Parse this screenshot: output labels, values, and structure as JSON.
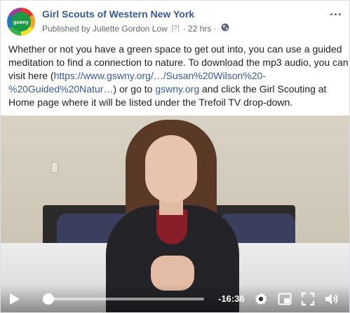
{
  "post": {
    "page_name": "Girl Scouts of Western New York",
    "published_by": "Published by Juliette Gordon Low",
    "help_marker": "[?]",
    "dot": "·",
    "time_ago": "22 hrs",
    "dot2": "·",
    "avatar_text": "gswny",
    "icons": {
      "more": "more-options-icon",
      "audience": "globe-icon"
    }
  },
  "body": {
    "text_1": "Whether or not you have a green space to get out into, you can use a guided meditation to find a connection to nature. To download the mp3 audio, you can visit here (",
    "link_1": "https://www.gswny.org/…/Susan%20Wilson%20-%20Guided%20Natur…",
    "text_2": ") or go to ",
    "link_2": "gswny.org",
    "text_3": " and click the Girl Scouting at Home page where it will be listed under the Trefoil TV drop-down."
  },
  "video": {
    "time_remaining": "-16:36",
    "progress_fraction": 0.02,
    "icons": {
      "play": "play-icon",
      "settings": "gear-icon",
      "pip": "picture-in-picture-icon",
      "fullscreen": "fullscreen-icon",
      "volume": "volume-icon"
    }
  },
  "colors": {
    "link": "#385898",
    "meta": "#616770",
    "text": "#1c1e21"
  }
}
